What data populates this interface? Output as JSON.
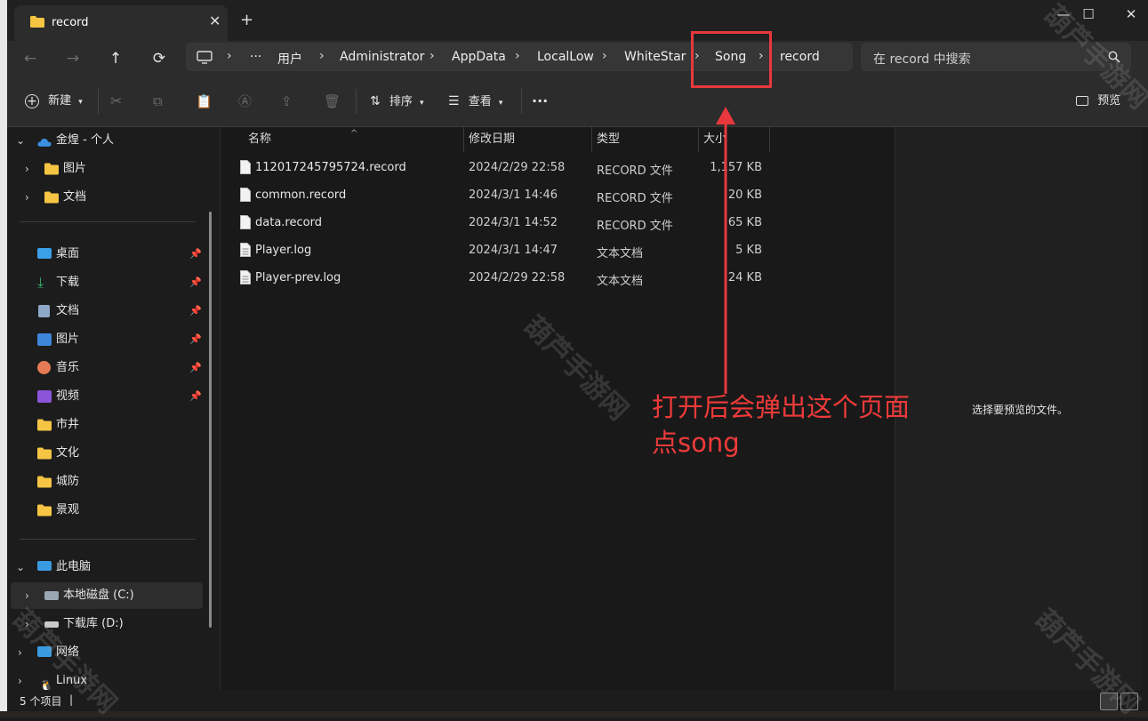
{
  "window": {
    "tab_title": "record",
    "close_tab": "✕",
    "new_tab": "+",
    "minimize": "—",
    "maximize": "☐",
    "close": "✕"
  },
  "address": {
    "more": "···",
    "crumbs": [
      "用户",
      "Administrator",
      "AppData",
      "LocalLow",
      "WhiteStar",
      "Song",
      "record"
    ],
    "sep": "›"
  },
  "search": {
    "placeholder": "在 record 中搜索"
  },
  "toolbar": {
    "new": "新建",
    "sort": "排序",
    "view": "查看",
    "more": "···",
    "preview": "预览"
  },
  "sidebar": {
    "onedrive": "金煌 - 个人",
    "od_items": [
      "图片",
      "文档"
    ],
    "quick": [
      {
        "label": "桌面",
        "pinned": true
      },
      {
        "label": "下载",
        "pinned": true
      },
      {
        "label": "文档",
        "pinned": true
      },
      {
        "label": "图片",
        "pinned": true
      },
      {
        "label": "音乐",
        "pinned": true
      },
      {
        "label": "视频",
        "pinned": true
      },
      {
        "label": "市井",
        "pinned": false
      },
      {
        "label": "文化",
        "pinned": false
      },
      {
        "label": "城防",
        "pinned": false
      },
      {
        "label": "景观",
        "pinned": false
      }
    ],
    "thispc": "此电脑",
    "drive_c": "本地磁盘 (C:)",
    "drive_d": "下载库 (D:)",
    "network": "网络",
    "linux": "Linux"
  },
  "columns": {
    "name": "名称",
    "date": "修改日期",
    "type": "类型",
    "size": "大小"
  },
  "files": [
    {
      "name": "112017245795724.record",
      "date": "2024/2/29 22:58",
      "type": "RECORD 文件",
      "size": "1,157 KB"
    },
    {
      "name": "common.record",
      "date": "2024/3/1 14:46",
      "type": "RECORD 文件",
      "size": "20 KB"
    },
    {
      "name": "data.record",
      "date": "2024/3/1 14:52",
      "type": "RECORD 文件",
      "size": "65 KB"
    },
    {
      "name": "Player.log",
      "date": "2024/3/1 14:47",
      "type": "文本文档",
      "size": "5 KB"
    },
    {
      "name": "Player-prev.log",
      "date": "2024/2/29 22:58",
      "type": "文本文档",
      "size": "24 KB"
    }
  ],
  "preview_pane": {
    "message": "选择要预览的文件。"
  },
  "status": {
    "count": "5 个项目",
    "divider": "|"
  },
  "annotation": {
    "line1": "打开后会弹出这个页面",
    "line2": "点song",
    "color": "#ef3a3a"
  },
  "watermark": "葫芦手游网",
  "colors": {
    "accent": "#4cc2ff",
    "folder": "#f5c543",
    "annotation": "#e8383d"
  }
}
